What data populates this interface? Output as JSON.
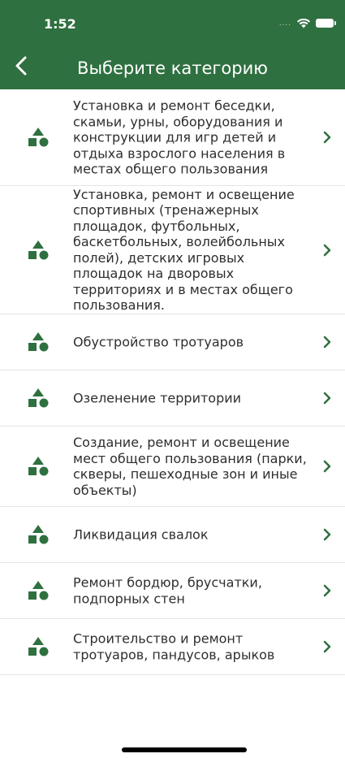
{
  "status_bar": {
    "time": "1:52",
    "dots": "...."
  },
  "header": {
    "title": "Выберите категорию"
  },
  "categories": [
    {
      "label": "Установка и ремонт беседки, скамьи, урны, оборудования и конструкции для игр детей и отдыха взрослого населения в местах общего пользования"
    },
    {
      "label": "Установка, ремонт и освещение спортивных (тренажерных площадок, футбольных, баскетбольных, волейбольных полей), детских игровых площадок на дворовых территориях и в местах общего пользования."
    },
    {
      "label": "Обустройство тротуаров"
    },
    {
      "label": "Озеленение территории"
    },
    {
      "label": "Создание, ремонт и освещение мест общего пользования (парки, скверы, пешеходные зон и иные объекты)"
    },
    {
      "label": "Ликвидация свалок"
    },
    {
      "label": "Ремонт бордюр, брусчатки, подпорных стен"
    },
    {
      "label": "Строительство и ремонт тротуаров, пандусов, арыков"
    }
  ],
  "colors": {
    "brand": "#2f7040",
    "icon": "#2f7040",
    "text": "#2e2e2e"
  },
  "icons": {
    "back": "back-chevron-icon",
    "category": "shapes-icon",
    "disclosure": "chevron-right-icon"
  }
}
